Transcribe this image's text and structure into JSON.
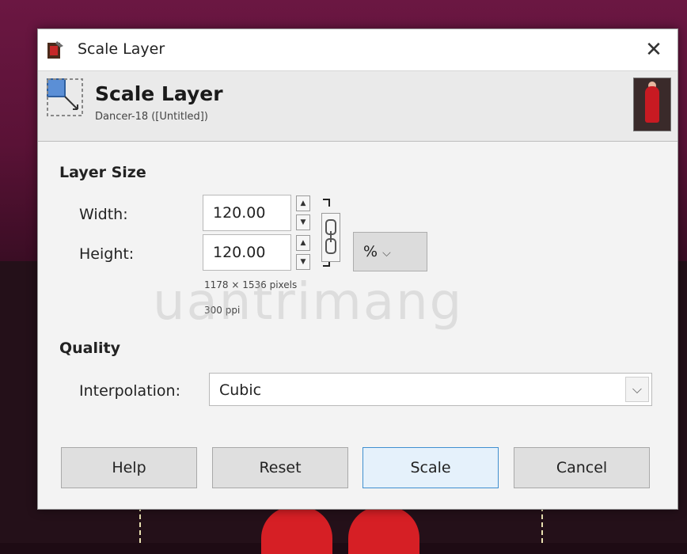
{
  "window": {
    "title": "Scale Layer"
  },
  "header": {
    "title": "Scale Layer",
    "subtitle": "Dancer-18 ([Untitled])"
  },
  "layer_size": {
    "label": "Layer Size",
    "width": {
      "label": "Width:",
      "value": "120.00"
    },
    "height": {
      "label": "Height:",
      "value": "120.00"
    },
    "unit": "%",
    "pixels_info": "1178 × 1536 pixels",
    "ppi_info": "300 ppi"
  },
  "quality": {
    "label": "Quality",
    "interpolation_label": "Interpolation:",
    "interpolation_value": "Cubic"
  },
  "buttons": {
    "help": "Help",
    "reset": "Reset",
    "scale": "Scale",
    "cancel": "Cancel"
  },
  "watermark": "uantrimang",
  "icons": [
    "gimp-app-icon",
    "close-icon",
    "scale-layer-icon",
    "layer-thumbnail",
    "chain-link-icon",
    "chevron-down-icon"
  ],
  "colors": {
    "accent": "#3f8fd0",
    "background": "#f3f3f3",
    "desktop": "#6b1742"
  }
}
